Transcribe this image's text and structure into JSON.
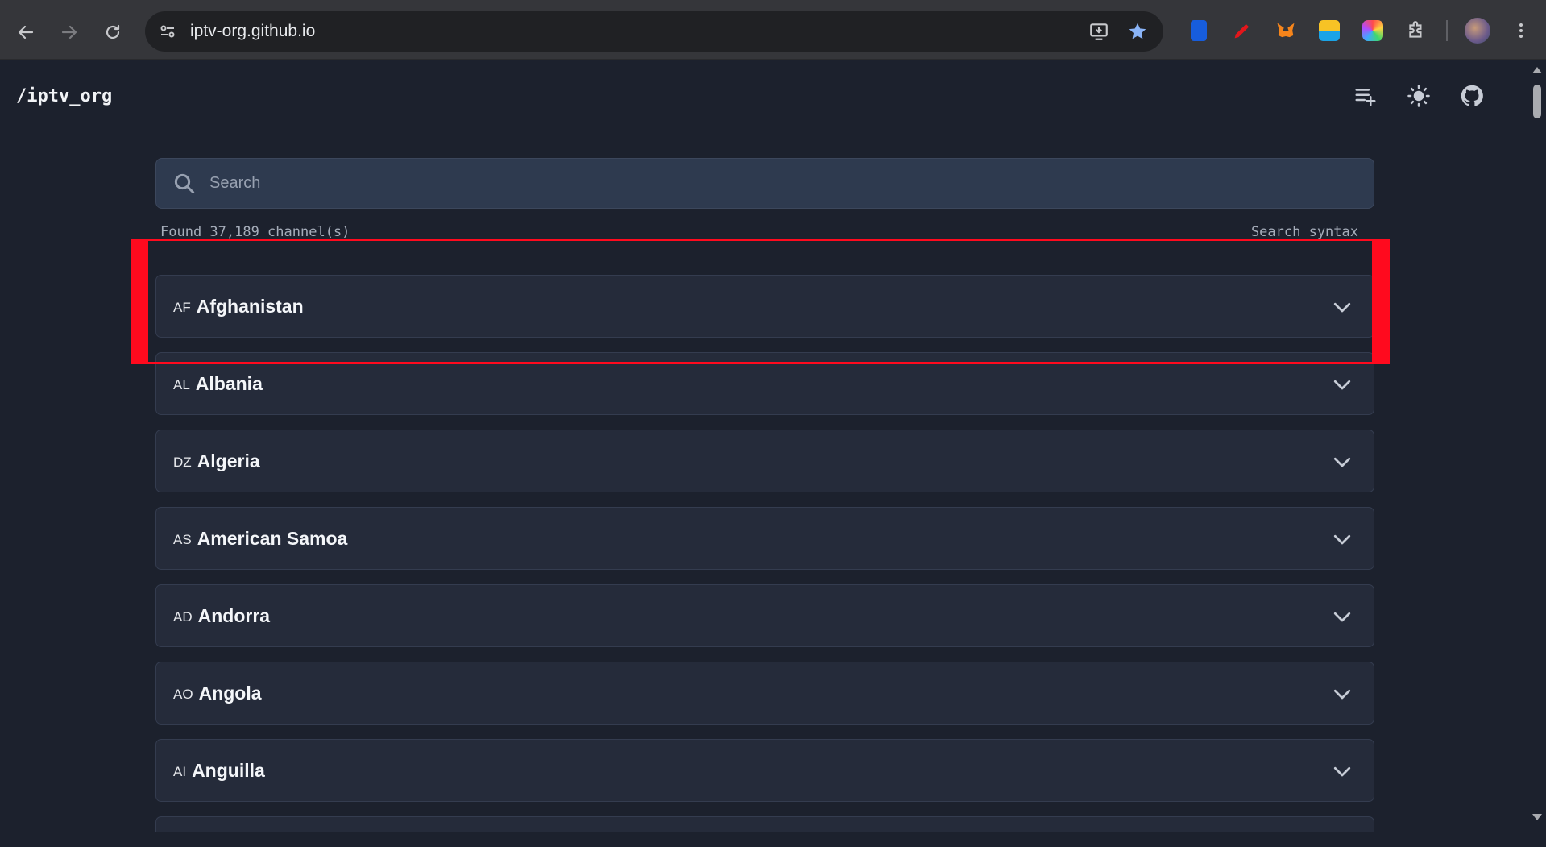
{
  "browser": {
    "url": "iptv-org.github.io",
    "extensions": [
      "bitwarden-icon",
      "highlighter-icon",
      "metamask-icon",
      "webp-converter-icon",
      "color-picker-icon",
      "extensions-puzzle-icon"
    ]
  },
  "header": {
    "logo": "/iptv_org",
    "icons": [
      "playlist-add-icon",
      "theme-toggle-sun-icon",
      "github-icon"
    ]
  },
  "search": {
    "placeholder": "Search",
    "value": ""
  },
  "results": {
    "found_text": "Found 37,189 channel(s)",
    "syntax_link": "Search syntax"
  },
  "countries": [
    {
      "code": "AF",
      "name": "Afghanistan"
    },
    {
      "code": "AL",
      "name": "Albania"
    },
    {
      "code": "DZ",
      "name": "Algeria"
    },
    {
      "code": "AS",
      "name": "American Samoa"
    },
    {
      "code": "AD",
      "name": "Andorra"
    },
    {
      "code": "AO",
      "name": "Angola"
    },
    {
      "code": "AI",
      "name": "Anguilla"
    }
  ],
  "colors": {
    "page_bg": "#1c212d",
    "card_bg": "#252b3a",
    "search_bg": "#2e3a4f",
    "highlight": "#ff0a1e"
  }
}
